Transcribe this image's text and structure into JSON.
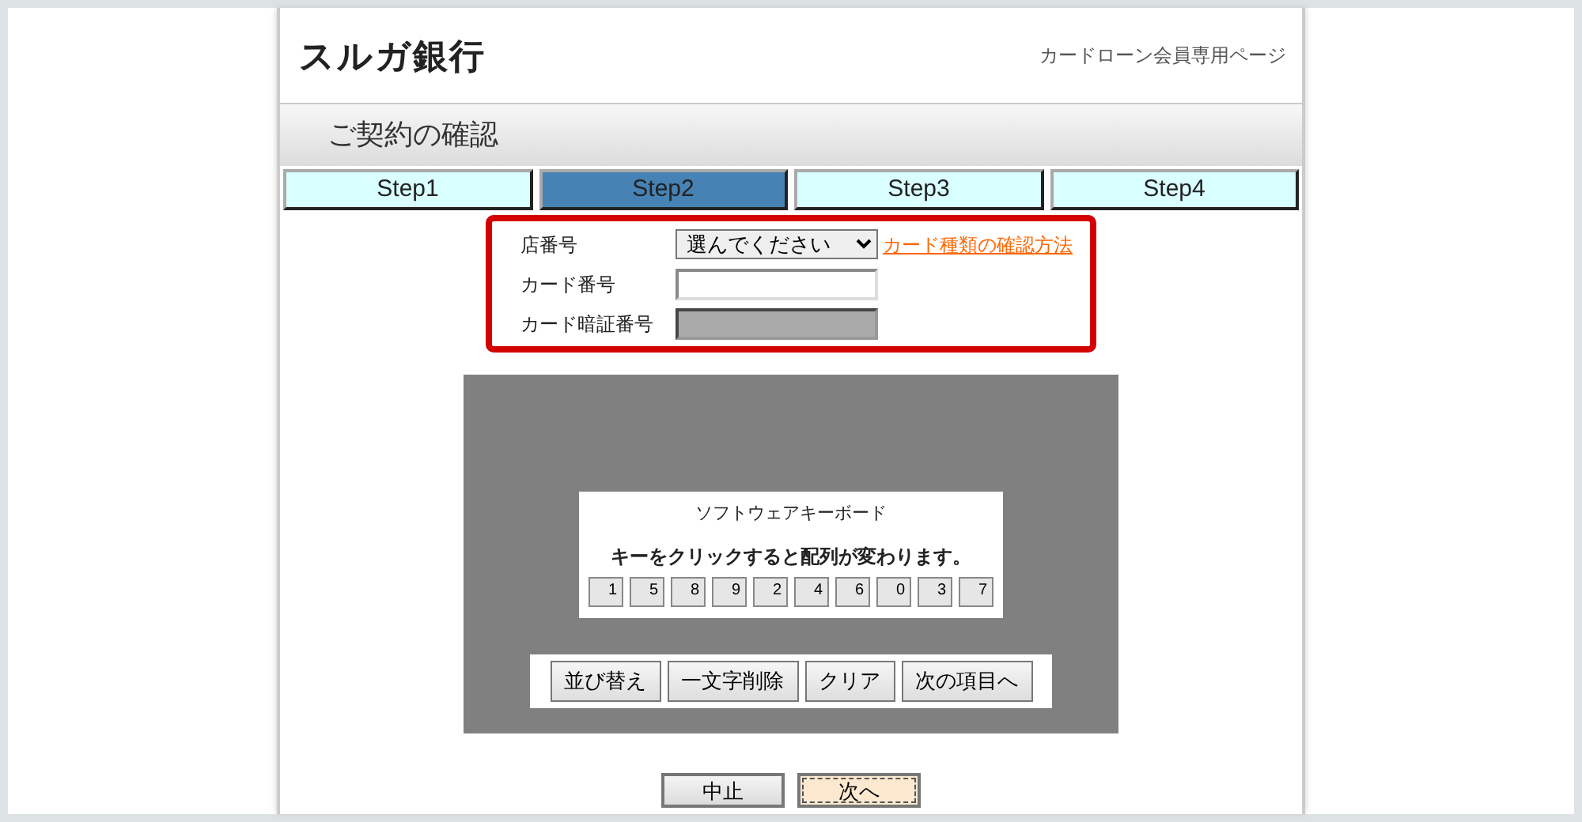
{
  "header": {
    "logo": "スルガ銀行",
    "subtitle": "カードローン会員専用ページ"
  },
  "page_title": "ご契約の確認",
  "steps": [
    {
      "label": "Step1",
      "selected": false
    },
    {
      "label": "Step2",
      "selected": true
    },
    {
      "label": "Step3",
      "selected": false
    },
    {
      "label": "Step4",
      "selected": false
    }
  ],
  "form": {
    "rows": [
      {
        "label": "店番号",
        "kind": "select",
        "value": "選んでください",
        "link": "カード種類の確認方法"
      },
      {
        "label": "カード番号",
        "kind": "text",
        "disabled": false
      },
      {
        "label": "カード暗証番号",
        "kind": "text",
        "disabled": true
      }
    ]
  },
  "keyboard": {
    "title": "ソフトウェアキーボード",
    "notice": "キーをクリックすると配列が変わります。",
    "keys": [
      "1",
      "5",
      "8",
      "9",
      "2",
      "4",
      "6",
      "0",
      "3",
      "7"
    ],
    "actions": [
      "並び替え",
      "一文字削除",
      "クリア",
      "次の項目へ"
    ]
  },
  "buttons": [
    {
      "label": "中止",
      "focused": false
    },
    {
      "label": "次へ",
      "focused": true
    }
  ]
}
